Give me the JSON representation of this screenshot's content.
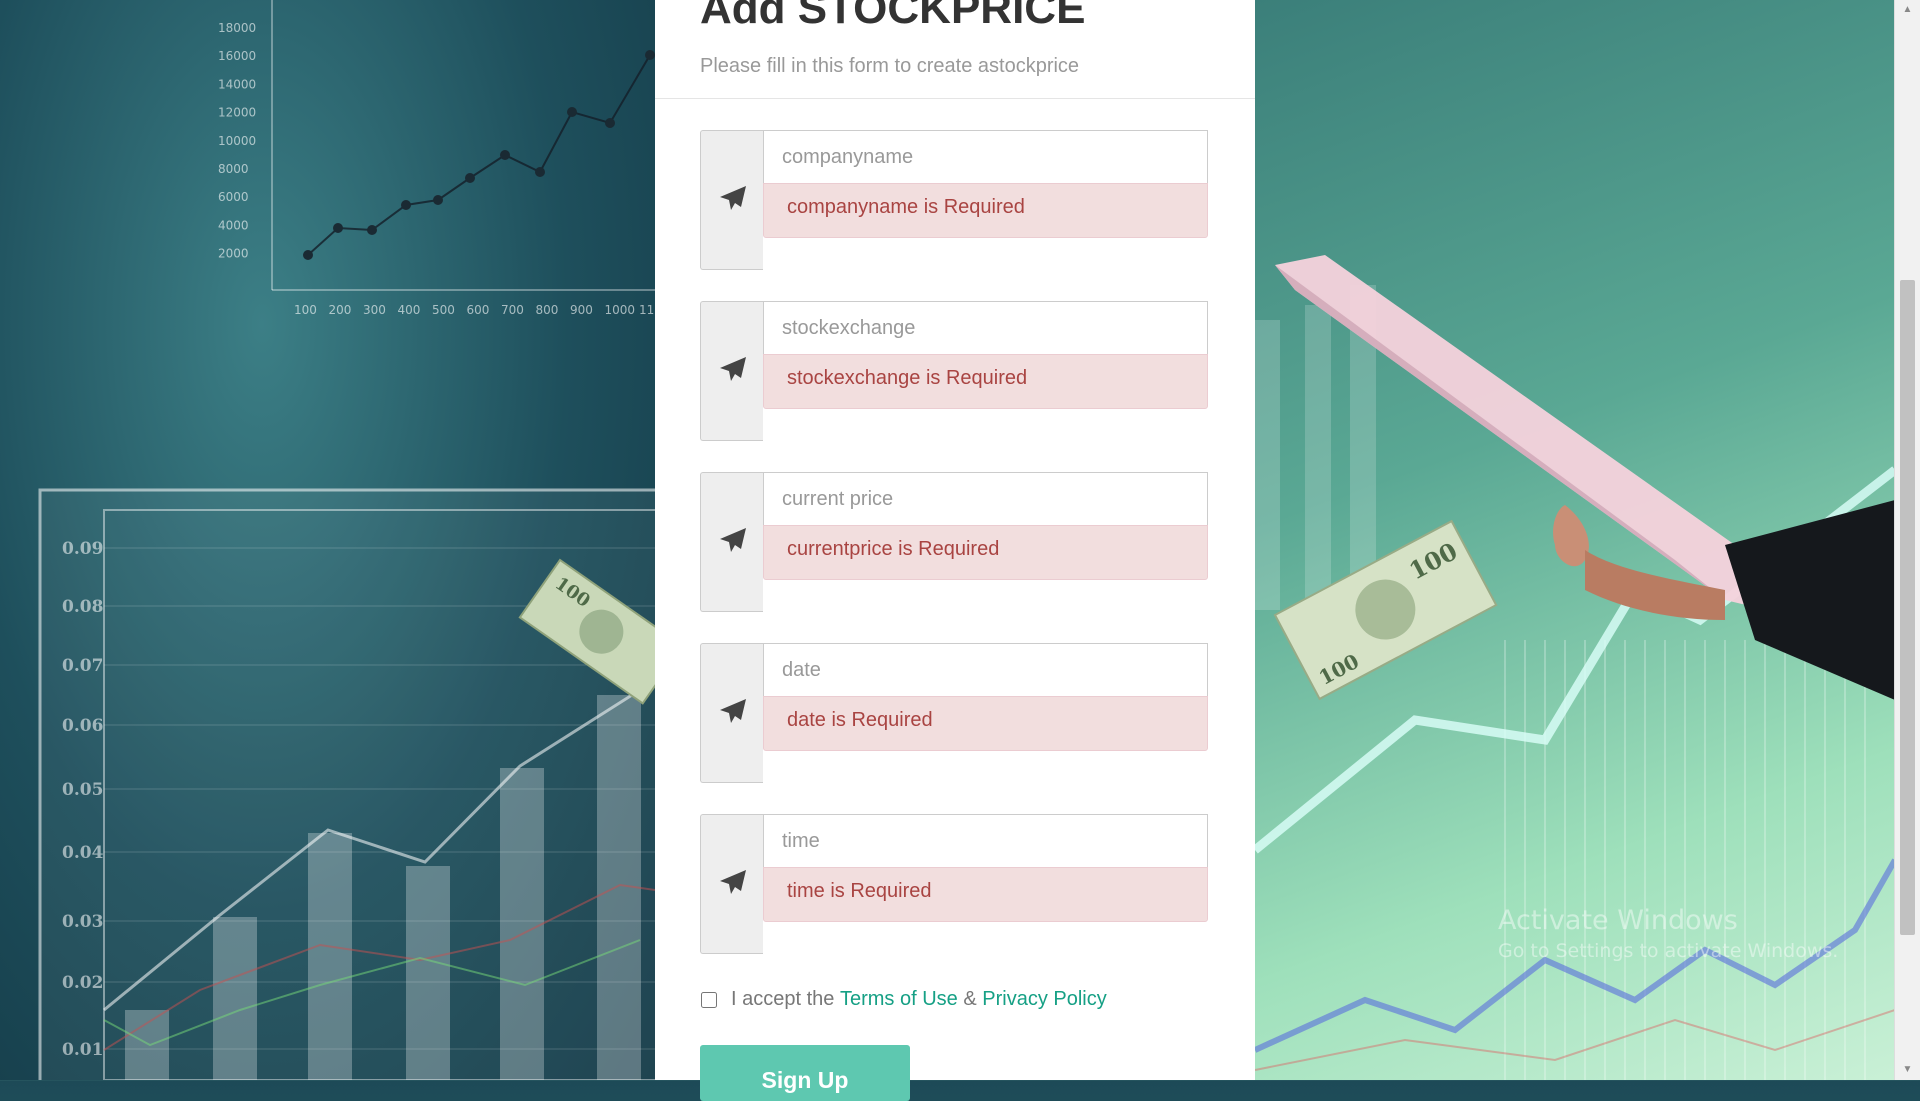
{
  "form": {
    "title": "Add STOCKPRICE",
    "subtitle": "Please fill in this form to create astockprice",
    "fields": [
      {
        "placeholder": "companyname",
        "error": "companyname is Required",
        "icon": "paper-plane-icon"
      },
      {
        "placeholder": "stockexchange",
        "error": "stockexchange is Required",
        "icon": "paper-plane-icon"
      },
      {
        "placeholder": "current price",
        "error": "currentprice is Required",
        "icon": "paper-plane-icon"
      },
      {
        "placeholder": "date",
        "error": "date is Required",
        "icon": "paper-plane-icon"
      },
      {
        "placeholder": "time",
        "error": "time is Required",
        "icon": "paper-plane-icon"
      }
    ],
    "terms": {
      "prefix": "I accept the",
      "terms_link": "Terms of Use",
      "separator": "&",
      "privacy_link": "Privacy Policy",
      "checked": false
    },
    "submit_label": "Sign Up"
  },
  "background": {
    "chart_top_y_ticks": [
      "18000",
      "16000",
      "14000",
      "12000",
      "10000",
      "8000",
      "6000",
      "4000",
      "2000"
    ],
    "chart_top_x_ticks": [
      "100",
      "200",
      "300",
      "400",
      "500",
      "600",
      "700",
      "800",
      "900",
      "1000",
      "11"
    ],
    "chart_bottom_y_ticks": [
      "0.09",
      "0.08",
      "0.07",
      "0.06",
      "0.05",
      "0.04",
      "0.03",
      "0.02",
      "0.01"
    ]
  },
  "watermark": {
    "title": "Activate Windows",
    "subtitle": "Go to Settings to activate Windows."
  },
  "colors": {
    "accent": "#16a085",
    "button": "#5ec8b0",
    "error_bg": "#f2dede",
    "error_text": "#a94442"
  }
}
